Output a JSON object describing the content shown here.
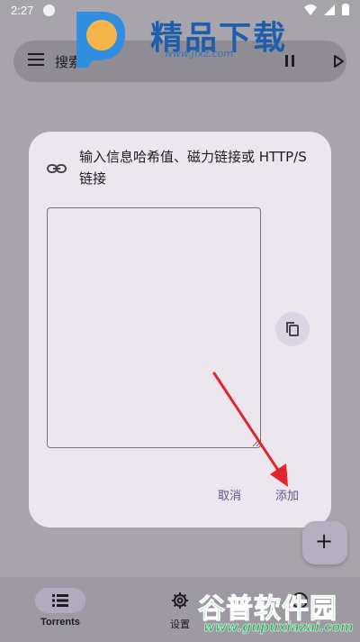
{
  "status_bar": {
    "time": "2:27"
  },
  "search_bar": {
    "label": "搜索"
  },
  "watermark_top": {
    "brand": "精品下载",
    "url": "www.jfxz.com"
  },
  "dialog": {
    "title": "输入信息哈希值、磁力链接或 HTTP/S 链接",
    "magnet_input": {
      "value": "",
      "placeholder": ""
    },
    "cancel_label": "取消",
    "add_label": "添加"
  },
  "fab": {
    "icon": "plus-icon",
    "label": "+"
  },
  "bottom_nav": {
    "items": [
      {
        "label": "Torrents",
        "icon": "list-icon",
        "active": true
      },
      {
        "label": "设置",
        "icon": "gear-icon",
        "active": false
      },
      {
        "label": "",
        "icon": "info-icon",
        "active": false
      }
    ]
  },
  "watermark_bottom": {
    "brand": "谷普软件园",
    "url": "www.gupuxiazai.com"
  },
  "colors": {
    "scrim": "#a8a4ab",
    "dialog_bg": "#ece6ee",
    "accent": "#65558f",
    "arrow": "#e0262a"
  }
}
